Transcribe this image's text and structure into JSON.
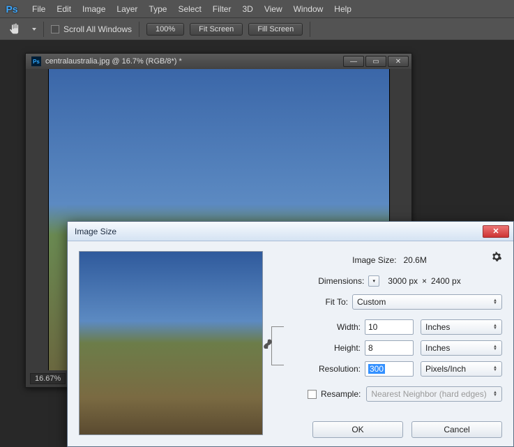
{
  "menubar": [
    "File",
    "Edit",
    "Image",
    "Layer",
    "Type",
    "Select",
    "Filter",
    "3D",
    "View",
    "Window",
    "Help"
  ],
  "options": {
    "scroll_all": "Scroll All Windows",
    "zoom_pct": "100%",
    "fit_screen": "Fit Screen",
    "fill_screen": "Fill Screen"
  },
  "document": {
    "title": "centralaustralia.jpg @ 16.7% (RGB/8*) *",
    "zoom_status": "16.67%"
  },
  "dialog": {
    "title": "Image Size",
    "image_size_label": "Image Size:",
    "image_size_value": "20.6M",
    "dimensions_label": "Dimensions:",
    "dimensions_value_w": "3000 px",
    "dimensions_times": "×",
    "dimensions_value_h": "2400 px",
    "fit_to_label": "Fit To:",
    "fit_to_value": "Custom",
    "width_label": "Width:",
    "width_value": "10",
    "width_unit": "Inches",
    "height_label": "Height:",
    "height_value": "8",
    "height_unit": "Inches",
    "resolution_label": "Resolution:",
    "resolution_value": "300",
    "resolution_unit": "Pixels/Inch",
    "resample_label": "Resample:",
    "resample_value": "Nearest Neighbor (hard edges)",
    "ok": "OK",
    "cancel": "Cancel"
  }
}
